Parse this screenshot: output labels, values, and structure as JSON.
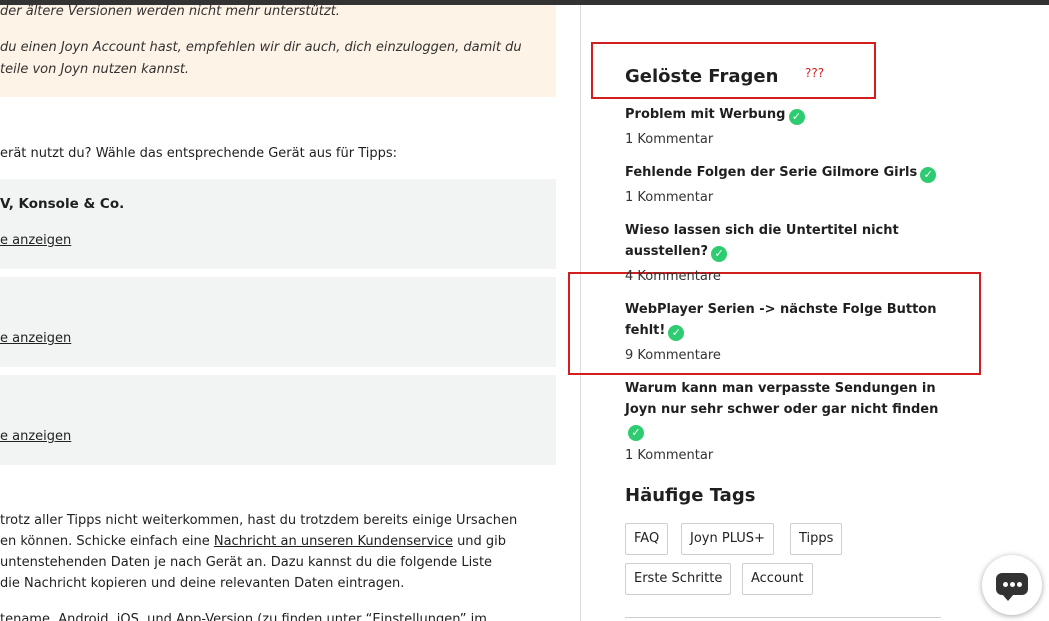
{
  "main": {
    "notice": {
      "line1": "der ältere Versionen werden nicht mehr unterstützt.",
      "line2": "du einen Joyn Account hast, empfehlen wir dir auch, dich einzuloggen, damit du",
      "line3": "teile von Joyn nutzen kannst."
    },
    "question": "erät nutzt du? Wähle das entsprechende Gerät aus für Tipps:",
    "devices": [
      {
        "title": "V, Konsole & Co.",
        "link": "e anzeigen"
      },
      {
        "title": "",
        "link": "e anzeigen"
      },
      {
        "title": "",
        "link": "e anzeigen"
      }
    ],
    "body": {
      "line1": "trotz aller Tipps nicht weiterkommen, hast du trotzdem bereits einige Ursachen",
      "line2_pre": "en können. Schicke einfach eine ",
      "line2_link": "Nachricht an unseren Kundenservice",
      "line2_post": " und gib",
      "line3": "untenstehenden Daten je nach Gerät an. Dazu kannst du die folgende Liste",
      "line4": "die Nachricht kopieren und deine relevanten Daten eintragen.",
      "line5": "tename, Android, iOS, und App-Version (zu finden unter “Einstellungen” im"
    }
  },
  "sidebar": {
    "solved_title": "Gelöste Fragen",
    "annotation": "???",
    "questions": [
      {
        "title": "Problem mit Werbung",
        "count": "1 Kommentar"
      },
      {
        "title": "Fehlende Folgen der Serie Gilmore Girls",
        "count": "1 Kommentar"
      },
      {
        "title": "Wieso lassen sich die Untertitel nicht ausstellen?",
        "count": "4 Kommentare"
      },
      {
        "title": "WebPlayer Serien -> nächste Folge Button fehlt!",
        "count": "9 Kommentare"
      },
      {
        "title": "Warum kann man verpasste Sendungen in Joyn nur sehr schwer oder gar nicht finden",
        "count": "1 Kommentar"
      }
    ],
    "tags_title": "Häufige Tags",
    "tags": [
      "FAQ",
      "Joyn PLUS+",
      "Tipps",
      "Erste Schritte",
      "Account"
    ]
  },
  "icons": {
    "check": "check-circle-icon",
    "chat": "chat-bubble-icon"
  },
  "colors": {
    "accent_check": "#2ecc71",
    "annotation_red": "#d21e1e",
    "notice_bg": "#fdf3e6",
    "card_bg": "#f1f4f3"
  }
}
